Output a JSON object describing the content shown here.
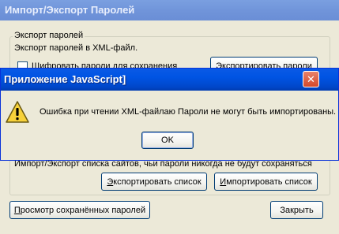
{
  "background_window": {
    "title": "Импорт/Экспорт Паролей",
    "export_group": {
      "label": "Экспорт паролей",
      "description": "Экспорт паролей в XML-файл.",
      "checkbox_label": "Шифровать пароли для сохранения",
      "export_button": "Экспортировать пароли"
    },
    "list_group": {
      "description": "Импорт/Экспорт списка сайтов, чьи пароли никогда не будут сохраняться",
      "export_list_button": {
        "hotkey": "Э",
        "rest": "кспортировать список"
      },
      "import_list_button": {
        "hotkey": "И",
        "rest": "мпортировать список"
      }
    },
    "view_saved_button": {
      "hotkey": "П",
      "rest": "росмотр сохранённых паролей"
    },
    "close_button": "Закрыть"
  },
  "dialog": {
    "title": "Приложение JavaScript]",
    "icon": "warning-icon",
    "message": "Ошибка при чтении XML-файлаю Пароли не могут быть импортированы.",
    "ok_button": "OK",
    "close_glyph": "✕"
  }
}
